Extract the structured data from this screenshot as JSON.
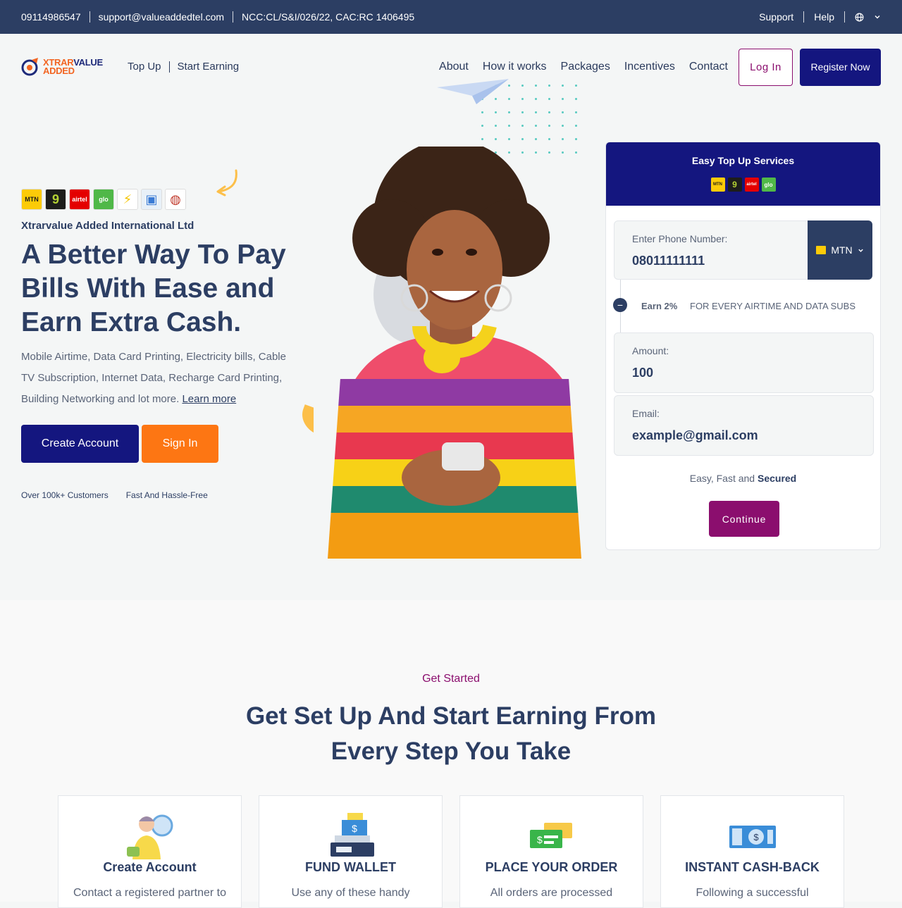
{
  "topbar": {
    "phone": "09114986547",
    "email": "support@valueaddedtel.com",
    "registration": "NCC:CL/S&I/026/22, CAC:RC 1406495",
    "links": [
      "Support",
      "Help"
    ]
  },
  "logo": {
    "line1_a": "XTRAR",
    "line1_b": "VALUE",
    "line2": "ADDED"
  },
  "nav": {
    "sub": [
      "Top Up",
      "Start Earning"
    ],
    "menu": [
      "About",
      "How it works",
      "Packages",
      "Incentives",
      "Contact"
    ],
    "login": "Log In",
    "register": "Register Now"
  },
  "hero": {
    "providers": [
      {
        "name": "mtn-logo",
        "label": "MTN",
        "bg": "#fccb08",
        "fg": "#1d1d1b"
      },
      {
        "name": "9mobile-logo",
        "label": "9",
        "bg": "#1d1d1b",
        "fg": "#b5d334"
      },
      {
        "name": "airtel-logo",
        "label": "airtel",
        "bg": "#e40000",
        "fg": "#ffffff"
      },
      {
        "name": "glo-logo",
        "label": "glo",
        "bg": "#50b848",
        "fg": "#ffffff"
      },
      {
        "name": "electricity-logo",
        "label": "⚡",
        "bg": "#ffffff",
        "fg": "#f5c500"
      },
      {
        "name": "cable-tv-logo",
        "label": "▣",
        "bg": "#e8f0f8",
        "fg": "#3a7bd5"
      },
      {
        "name": "international-logo",
        "label": "◍",
        "bg": "#ffffff",
        "fg": "#c0392b"
      }
    ],
    "company": "Xtrarvalue Added International Ltd",
    "headline": "A Better Way To Pay Bills With Ease and Earn Extra Cash.",
    "description": "Mobile Airtime, Data Card Printing, Electricity bills, Cable TV Subscription, Internet Data, Recharge Card Printing, Building Networking and lot more.",
    "learn_more": "Learn more",
    "create_account": "Create Account",
    "sign_in": "Sign In",
    "stats": [
      "Over 100k+ Customers",
      "Fast And Hassle-Free"
    ]
  },
  "topup_card": {
    "title": "Easy Top Up Services",
    "phone_label": "Enter Phone Number:",
    "phone_value": "08011111111",
    "network": "MTN",
    "earn_rate": "Earn 2%",
    "earn_text": "FOR EVERY AIRTIME AND DATA SUBS",
    "amount_label": "Amount:",
    "amount_value": "100",
    "email_label": "Email:",
    "email_value": "example@gmail.com",
    "secure_prefix": "Easy, Fast and",
    "secure_bold": "Secured",
    "continue": "Continue"
  },
  "get_started": {
    "eyebrow": "Get Started",
    "heading": "Get Set Up And Start Earning From Every Step You Take",
    "steps": [
      {
        "title": "Create Account",
        "desc": "Contact a registered partner to",
        "icon": "user-account-icon"
      },
      {
        "title": "FUND WALLET",
        "desc": "Use any of these handy",
        "icon": "wallet-register-icon"
      },
      {
        "title": "PLACE YOUR ORDER",
        "desc": "All orders are processed",
        "icon": "money-order-icon"
      },
      {
        "title": "INSTANT CASH-BACK",
        "desc": "Following a successful",
        "icon": "cashback-banknote-icon"
      }
    ]
  }
}
